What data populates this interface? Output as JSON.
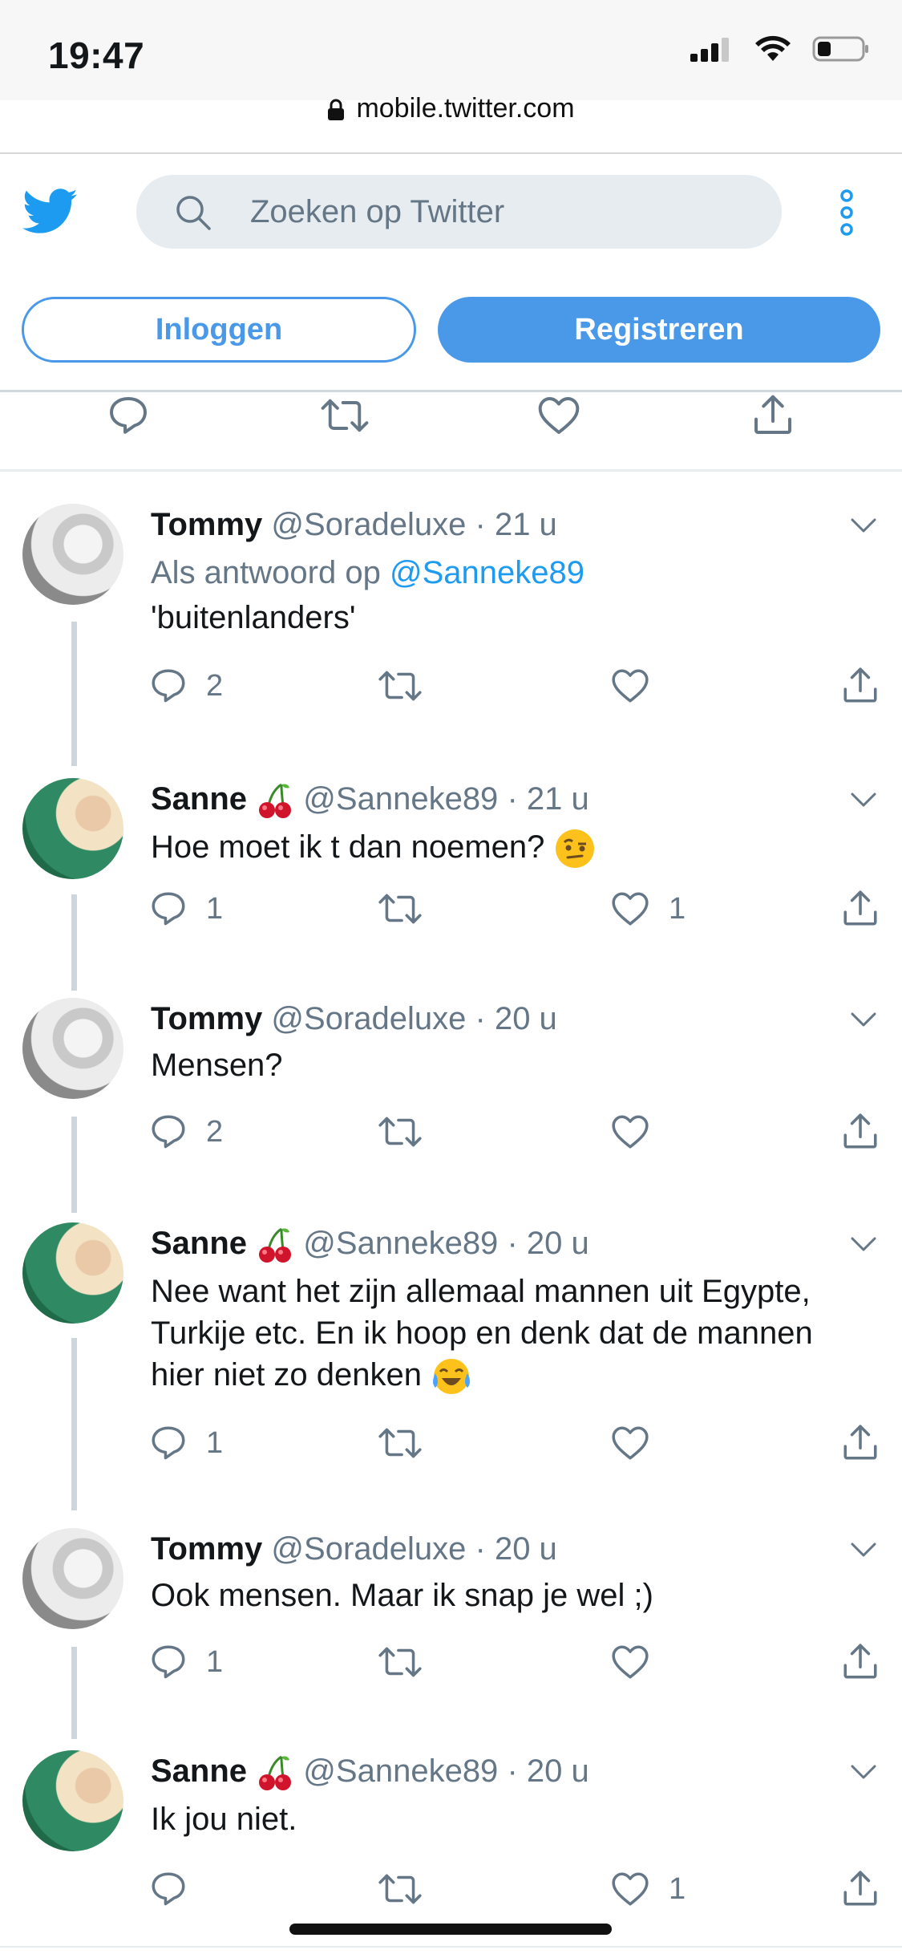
{
  "status_bar": {
    "time": "19:47"
  },
  "browser": {
    "url": "mobile.twitter.com"
  },
  "header": {
    "search_placeholder": "Zoeken op Twitter",
    "login_label": "Inloggen",
    "register_label": "Registreren"
  },
  "colors": {
    "accent": "#4a99e9",
    "secondary_text": "#657786",
    "mention": "#1d9bf0",
    "divider": "#e6ecf0"
  },
  "tweets": [
    {
      "name": "Tommy",
      "handle": "@Soradeluxe",
      "time": "21 u",
      "reply_prefix": "Als antwoord op",
      "reply_mention": "@Sanneke89",
      "text": "'buitenlanders'",
      "replies": "2",
      "likes": ""
    },
    {
      "name": "Sanne",
      "handle": "@Sanneke89",
      "time": "21 u",
      "text": "Hoe moet ik t dan noemen?",
      "replies": "1",
      "likes": "1"
    },
    {
      "name": "Tommy",
      "handle": "@Soradeluxe",
      "time": "20 u",
      "text": "Mensen?",
      "replies": "2",
      "likes": ""
    },
    {
      "name": "Sanne",
      "handle": "@Sanneke89",
      "time": "20 u",
      "text_lines": [
        "Nee want het zijn allemaal mannen uit Egypte,",
        "Turkije etc. En ik hoop en denk dat de mannen",
        "hier niet zo denken"
      ],
      "replies": "1",
      "likes": ""
    },
    {
      "name": "Tommy",
      "handle": "@Soradeluxe",
      "time": "20 u",
      "text": "Ook mensen. Maar ik snap je wel ;)",
      "replies": "1",
      "likes": ""
    },
    {
      "name": "Sanne",
      "handle": "@Sanneke89",
      "time": "20 u",
      "text": "Ik jou niet.",
      "replies": "",
      "likes": "1"
    }
  ]
}
